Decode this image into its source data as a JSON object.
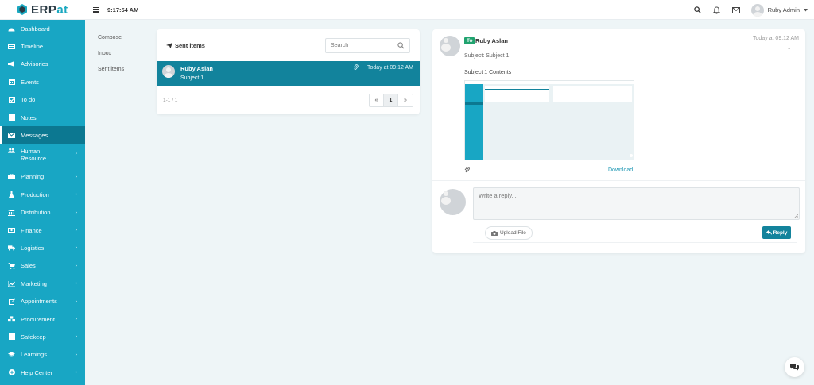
{
  "app": {
    "name_part1": "ERP",
    "name_part2": "at"
  },
  "topbar": {
    "time": "9:17:54 AM",
    "user_name": "Ruby Admin"
  },
  "sidebar": {
    "items": [
      {
        "label": "Dashboard",
        "icon": "dashboard-icon"
      },
      {
        "label": "Timeline",
        "icon": "timeline-icon"
      },
      {
        "label": "Advisories",
        "icon": "megaphone-icon"
      },
      {
        "label": "Events",
        "icon": "calendar-icon"
      },
      {
        "label": "To do",
        "icon": "checkbox-icon"
      },
      {
        "label": "Notes",
        "icon": "note-icon"
      },
      {
        "label": "Messages",
        "icon": "envelope-icon",
        "active": true
      },
      {
        "label": "Human Resource",
        "icon": "users-icon",
        "chevron": "›"
      },
      {
        "label": "Planning",
        "icon": "briefcase-icon",
        "chevron": "›"
      },
      {
        "label": "Production",
        "icon": "flask-icon",
        "chevron": "›"
      },
      {
        "label": "Distribution",
        "icon": "bank-icon",
        "chevron": "›"
      },
      {
        "label": "Finance",
        "icon": "money-icon",
        "chevron": "›"
      },
      {
        "label": "Logistics",
        "icon": "truck-icon",
        "chevron": "›"
      },
      {
        "label": "Sales",
        "icon": "cart-icon",
        "chevron": "›"
      },
      {
        "label": "Marketing",
        "icon": "chart-line-icon",
        "chevron": "›"
      },
      {
        "label": "Appointments",
        "icon": "edit-icon",
        "chevron": "›"
      },
      {
        "label": "Procurement",
        "icon": "cubes-icon",
        "chevron": "›"
      },
      {
        "label": "Safekeep",
        "icon": "archive-icon",
        "chevron": "›"
      },
      {
        "label": "Learnings",
        "icon": "graduation-icon",
        "chevron": "›"
      },
      {
        "label": "Help Center",
        "icon": "help-icon",
        "chevron": "›"
      }
    ]
  },
  "submenu": {
    "items": [
      "Compose",
      "Inbox",
      "Sent items"
    ]
  },
  "list": {
    "title": "Sent items",
    "search_placeholder": "Search",
    "message": {
      "from": "Ruby Aslan",
      "subject": "Subject 1",
      "time": "Today at 09:12 AM"
    },
    "range": "1-1 / 1",
    "pager": {
      "prev": "«",
      "page": "1",
      "next": "»"
    }
  },
  "detail": {
    "badge": "To",
    "from": "Ruby Aslan",
    "time": "Today at 09:12 AM",
    "subject_line": "Subject: Subject 1",
    "content": "Subject 1 Contents",
    "download": "Download",
    "reply_placeholder": "Write a reply...",
    "upload_label": "Upload File",
    "reply_label": "Reply"
  },
  "colors": {
    "sidebar": "#18a6c4",
    "active": "#0c7891",
    "accent": "#13839c",
    "badge": "#20a36f"
  }
}
